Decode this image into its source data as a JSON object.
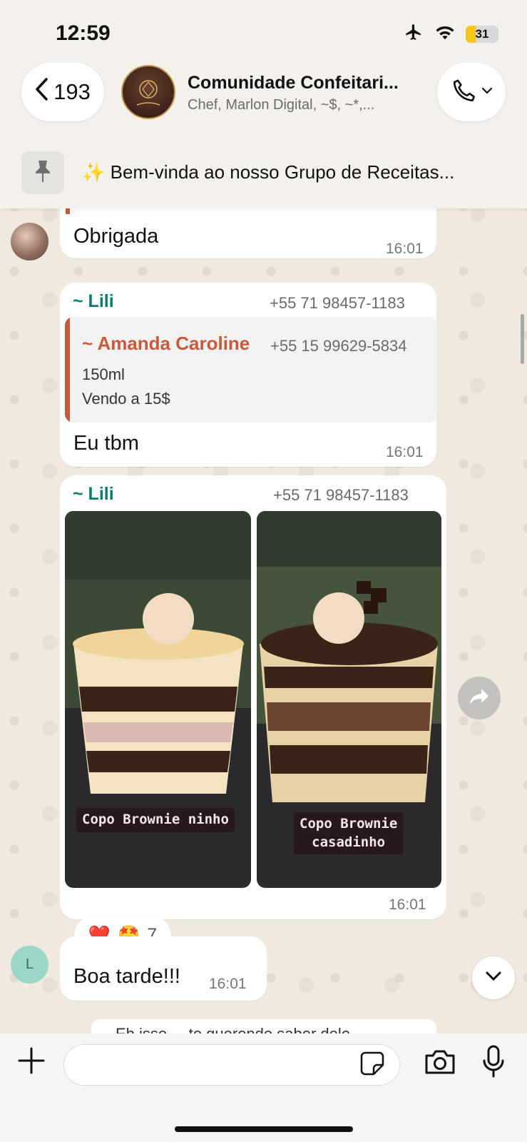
{
  "status_bar": {
    "time": "12:59",
    "battery": "31"
  },
  "header": {
    "back_count": "193",
    "title": "Comunidade Confeitari...",
    "subtitle": "Chef, Marlon Digital, ~$, ~*,..."
  },
  "pinned": {
    "emoji": "✨",
    "text": "Bem-vinda ao nosso Grupo de Receitas..."
  },
  "messages": [
    {
      "text": "Obrigada",
      "time": "16:01"
    },
    {
      "sender": "~ Lili",
      "phone": "+55 71 98457-1183",
      "quote": {
        "sender": "~ Amanda Caroline",
        "phone": "+55 15 99629-5834",
        "line1": "150ml",
        "line2": "Vendo a 15$"
      },
      "text": "Eu tbm",
      "time": "16:01"
    },
    {
      "sender": "~ Lili",
      "phone": "+55 71 98457-1183",
      "images": [
        {
          "caption": "Copo Brownie ninho"
        },
        {
          "caption_line1": "Copo Brownie",
          "caption_line2": "casadinho"
        }
      ],
      "time": "16:01",
      "reactions": {
        "emoji1": "❤️",
        "emoji2": "🤩",
        "count": "7"
      }
    },
    {
      "avatar_letter": "L",
      "text": "Boa tarde!!!",
      "time": "16:01"
    }
  ],
  "peek_text": "Eh isso ... to querendo saber dele..",
  "composer": {
    "placeholder": ""
  },
  "colors": {
    "sender_name": "#0b7c6f",
    "quote_sender": "#c75a3a",
    "background": "#efeae2"
  }
}
